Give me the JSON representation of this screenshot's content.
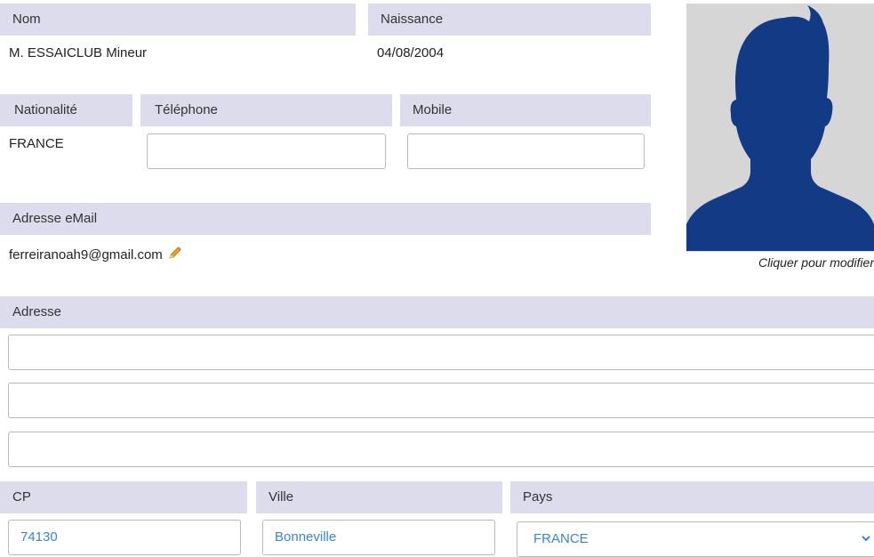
{
  "identity": {
    "nom_label": "Nom",
    "nom_value": "M. ESSAICLUB Mineur",
    "naissance_label": "Naissance",
    "naissance_value": "04/08/2004"
  },
  "contact": {
    "nationalite_label": "Nationalité",
    "nationalite_value": "FRANCE",
    "telephone_label": "Téléphone",
    "telephone_value": "",
    "mobile_label": "Mobile",
    "mobile_value": "",
    "email_label": "Adresse eMail",
    "email_value": "ferreiranoah9@gmail.com",
    "edit_icon": "pencil-icon"
  },
  "photo": {
    "caption": "Cliquer pour modifier",
    "icon": "person-silhouette",
    "silhouette_color": "#123a85",
    "background_color": "#d6d6d6"
  },
  "address": {
    "label": "Adresse",
    "line1": "",
    "line2": "",
    "line3": "",
    "cp_label": "CP",
    "cp_value": "74130",
    "ville_label": "Ville",
    "ville_value": "Bonneville",
    "pays_label": "Pays",
    "pays_value": "FRANCE"
  },
  "colors": {
    "label_background": "#dcdcec",
    "input_text": "#3a86c8"
  }
}
